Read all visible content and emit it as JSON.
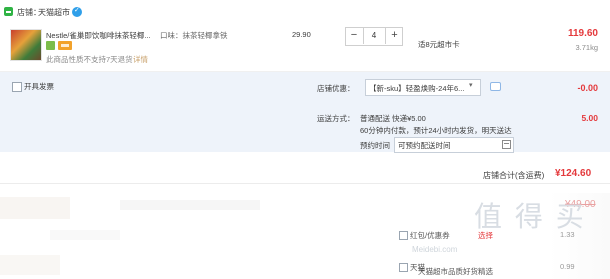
{
  "store": {
    "label": "店铺：",
    "name": "天猫超市"
  },
  "item": {
    "title": "Nestle/雀巢即饮咖啡抹茶轻椰...",
    "attr": "口味：抹茶轻椰拿铁",
    "no_return": "此商品性质不支持7天退货",
    "no_return_detail": "详情",
    "unit_price": "29.90",
    "quantity": "4",
    "promo": "适8元超市卡",
    "price_total": "119.60",
    "weight": "3.71kg"
  },
  "invoice": {
    "label": "开具发票"
  },
  "discount": {
    "label": "店铺优惠：",
    "selected": "【新-sku】轻盈焕购-24年6...",
    "amount": "-0.00"
  },
  "shipping": {
    "label": "运送方式：",
    "option": "普通配送 快递¥5.00",
    "desc": "60分钟内付款，预计24小时内发货，明天送达",
    "appt_label": "预约时间",
    "appt_value": "可预约配送时间",
    "amount": "5.00"
  },
  "totals": {
    "label": "店铺合计(含运费)",
    "amount": "¥124.60"
  },
  "background_faded": {
    "checkbox1": "红包/优惠券",
    "red": "选择",
    "checkbox2": "天猫",
    "text3": "天猫超市品质好货精选",
    "struck": "¥49.00",
    "right1": "1.33",
    "right2": "0.99",
    "watermark": "值 得 买",
    "watermark_sub": "Meidebi.com"
  },
  "colors": {
    "accent_red": "#e4393c",
    "panel_bg": "#eef3fa"
  }
}
